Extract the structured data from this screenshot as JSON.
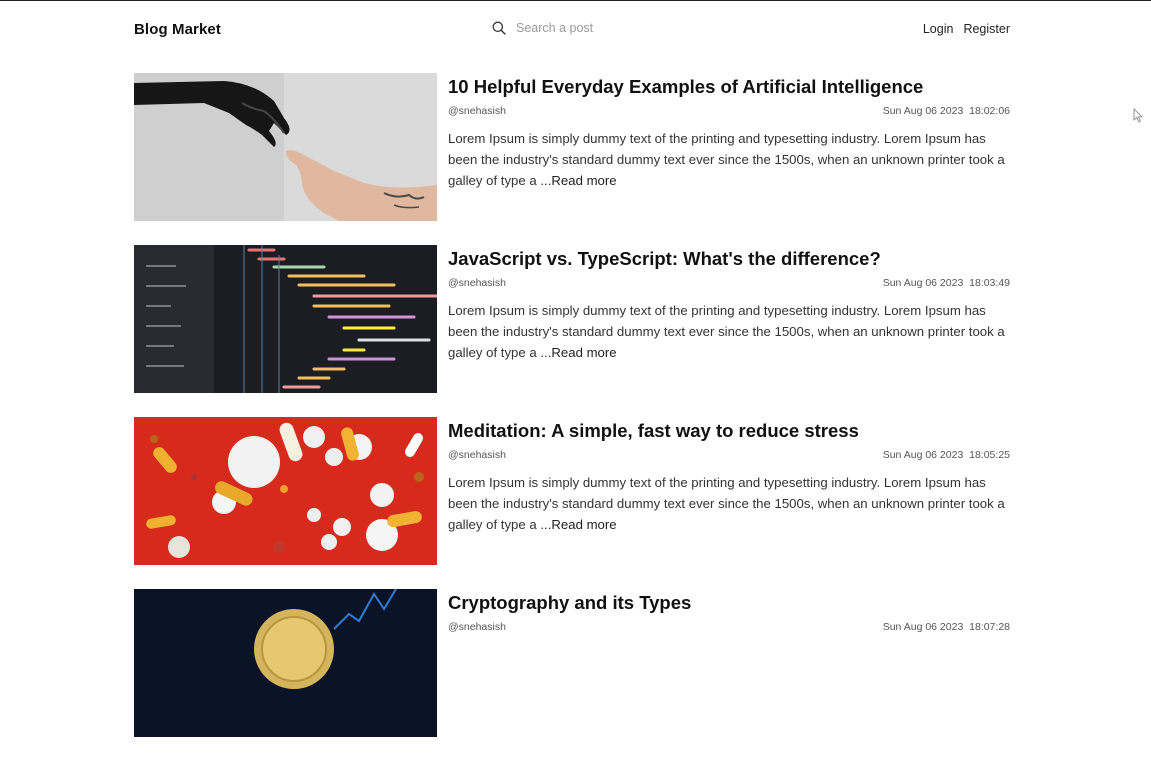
{
  "header": {
    "brand": "Blog Market",
    "search_placeholder": "Search a post",
    "login": "Login",
    "register": "Register"
  },
  "posts": [
    {
      "title": "10 Helpful Everyday Examples of Artificial Intelligence",
      "author": "@snehasish",
      "date": "Sun Aug 06 2023",
      "time": "18:02:06",
      "summary": "Lorem Ipsum is simply dummy text of the printing and typesetting industry. Lorem Ipsum has been the industry's standard dummy text ever since the 1500s, when an unknown printer took a galley of type a ...",
      "read_more": "Read more"
    },
    {
      "title": "JavaScript vs. TypeScript: What's the difference?",
      "author": "@snehasish",
      "date": "Sun Aug 06 2023",
      "time": "18:03:49",
      "summary": "Lorem Ipsum is simply dummy text of the printing and typesetting industry. Lorem Ipsum has been the industry's standard dummy text ever since the 1500s, when an unknown printer took a galley of type a ...",
      "read_more": "Read more"
    },
    {
      "title": "Meditation: A simple, fast way to reduce stress",
      "author": "@snehasish",
      "date": "Sun Aug 06 2023",
      "time": "18:05:25",
      "summary": "Lorem Ipsum is simply dummy text of the printing and typesetting industry. Lorem Ipsum has been the industry's standard dummy text ever since the 1500s, when an unknown printer took a galley of type a ...",
      "read_more": "Read more"
    },
    {
      "title": "Cryptography and its Types",
      "author": "@snehasish",
      "date": "Sun Aug 06 2023",
      "time": "18:07:28",
      "summary": "",
      "read_more": ""
    }
  ]
}
